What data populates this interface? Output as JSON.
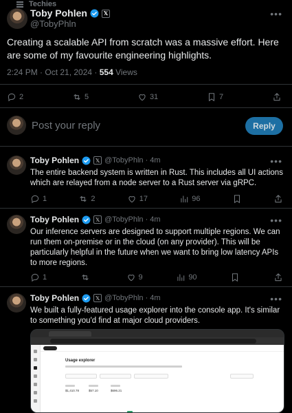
{
  "community": {
    "name": "Techies"
  },
  "main_tweet": {
    "author_name": "Toby Pohlen",
    "author_handle": "@TobyPhln",
    "text": "Creating a scalable API from scratch was a massive effort. Here are some of my favourite engineering highlights.",
    "time": "2:24 PM · Oct 21, 2024 · ",
    "views_count": "554",
    "views_label": " Views",
    "stats": {
      "replies": "2",
      "reposts": "5",
      "likes": "31",
      "bookmarks": "7"
    }
  },
  "reply_box": {
    "placeholder": "Post your reply",
    "button_label": "Reply"
  },
  "replies": [
    {
      "name": "Toby Pohlen",
      "handle": "@TobyPhln · 4m",
      "text": "The entire backend system is written in Rust. This includes all UI actions which are relayed from a node server to a Rust server via gRPC.",
      "stats": {
        "replies": "1",
        "reposts": "2",
        "likes": "17",
        "views": "96"
      }
    },
    {
      "name": "Toby Pohlen",
      "handle": "@TobyPhln · 4m",
      "text": "Our inference servers are designed to support multiple regions. We can run them on-premise or in the cloud (on any provider). This will be particularly helpful in the future when we want to bring low latency APIs to more regions.",
      "stats": {
        "replies": "1",
        "reposts": "",
        "likes": "9",
        "views": "90"
      }
    },
    {
      "name": "Toby Pohlen",
      "handle": "@TobyPhln · 4m",
      "text": "We built a fully-featured usage explorer into the console app. It's similar to something you'd find at major cloud providers."
    }
  ],
  "screenshot": {
    "title": "Usage explorer",
    "stats": [
      "$1,410.78",
      "$57.10",
      "$696.21"
    ]
  },
  "colors": {
    "verified": "#1d9bf0",
    "reply_button": "#1d6fa3",
    "divider": "#2f3336"
  }
}
